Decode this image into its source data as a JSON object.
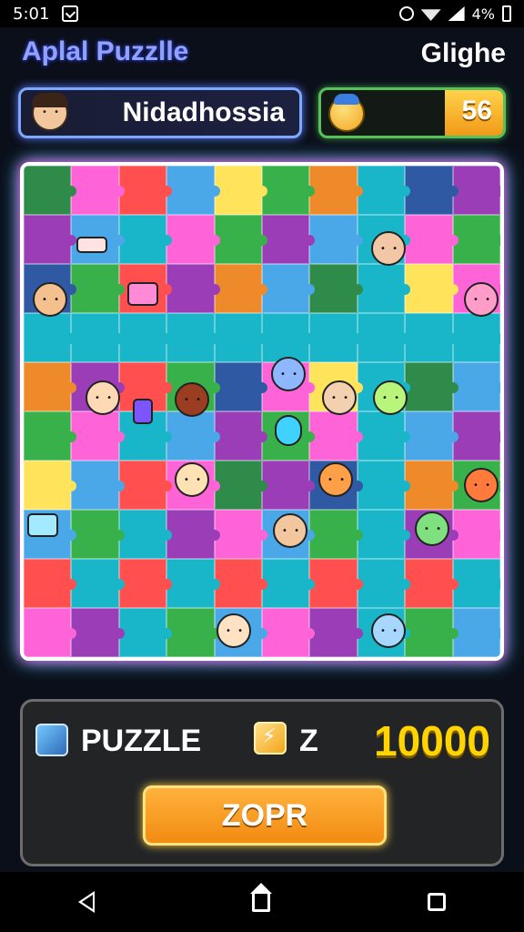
{
  "status_bar": {
    "time": "5:01",
    "battery": "4%"
  },
  "header": {
    "title": "Aplal Puzzlle",
    "right_label": "Glighe"
  },
  "player": {
    "name": "Nidadhossia",
    "avatar_icon": "player-avatar-icon"
  },
  "coins": {
    "value": "56",
    "icon": "mascot-icon"
  },
  "board": {
    "rows": 10,
    "cols": 10,
    "colors": [
      "#2f8b4a",
      "#4aa7e8",
      "#ef8a2a",
      "#9c3db8",
      "#ff4f4f",
      "#39b14a",
      "#2f5aa3",
      "#ff63d8",
      "#ffe35a",
      "#19b5c8"
    ]
  },
  "panel": {
    "puzzle_label": "PUZZLE",
    "z_label": "Z",
    "score": "10000",
    "play_button": "ZOPR"
  },
  "nav": {
    "back_icon": "back-icon",
    "home_icon": "home-icon",
    "recent_icon": "recent-apps-icon"
  }
}
